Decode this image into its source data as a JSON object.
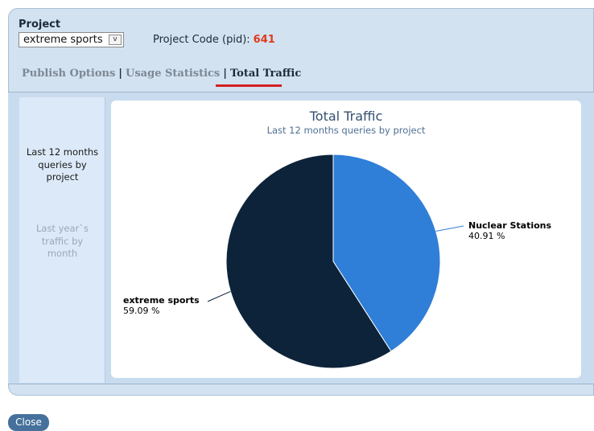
{
  "project": {
    "label": "Project",
    "selected": "extreme sports",
    "dropdown_arrow": "v",
    "code_label": "Project Code (pid):",
    "code_value": "641"
  },
  "tabs": [
    {
      "label": "Publish Options"
    },
    {
      "label": "Usage Statistics"
    },
    {
      "label": "Total Traffic",
      "active": true
    }
  ],
  "tab_separator": "|",
  "sidebar": {
    "items": [
      {
        "label": "Last 12 months queries by project",
        "active": true
      },
      {
        "label": "Last year`s traffic by month",
        "active": false
      }
    ]
  },
  "chart_data": {
    "type": "pie",
    "title": "Total Traffic",
    "subtitle": "Last 12 months queries by project",
    "slices": [
      {
        "label": "Nuclear Stations",
        "value": 40.91,
        "display": "40.91 %",
        "color": "#2f7ed8"
      },
      {
        "label": "extreme sports",
        "value": 59.09,
        "display": "59.09 %",
        "color": "#0d233a"
      }
    ]
  },
  "footer": {
    "close_label": "Close"
  }
}
